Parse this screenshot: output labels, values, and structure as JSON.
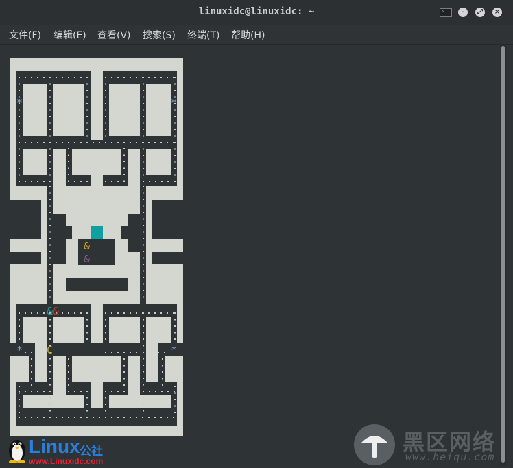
{
  "window": {
    "title": "linuxidc@linuxidc: ~"
  },
  "menu": [
    "文件(F)",
    "编辑(E)",
    "查看(V)",
    "搜索(S)",
    "终端(T)",
    "帮助(H)"
  ],
  "game": {
    "maze_rows": [
      "##############",
      "#......#.....##",
      "#.##.#.#.#.#.#",
      "*.##.#.#.#.#.*",
      "#.##.#.#.#.#.#",
      "#.##.#.#.#.#.#",
      "#.............#",
      "#.##.####.##.#",
      "#.##.####.##.#",
      "#....##.##....#",
      "###.###.###.###",
      "   .#.....#.   ",
      "   .#.###.#.   ",
      "###.#.# #.#.###",
      "   ...# #...   ",
      "###.#.###.#.###",
      "   .#.....#.   ",
      "###.#.###.#.###",
      "#.....##.....#",
      "#.##.#.#.#.#.#",
      "*..#.......#..*",
      "##.#.#####.#.##",
      "#....#.#.#....#",
      "#.######.#####.#",
      "#.............#",
      "##############"
    ],
    "ghosts": [
      {
        "glyph": "&",
        "color": "#c9a227"
      },
      {
        "glyph": "&",
        "color": "#8a5a8a"
      },
      {
        "glyph": "&",
        "color": "#1f9a9a"
      },
      {
        "glyph": "&",
        "color": "#c0392b"
      }
    ],
    "player": {
      "glyph": "C",
      "color": "#c9a227"
    },
    "power_pellet": "*",
    "pellet": "."
  },
  "branding": {
    "left_word": "Linux",
    "left_cn": "公社",
    "left_url": "www.Linuxidc.com",
    "right_cn": "黑区网络",
    "right_url": "www.heiqu.com"
  },
  "colors": {
    "wall": "#d3d7cf",
    "bg": "#2e3436",
    "pellet": "#c8ccc4",
    "power": "#7aa6d8",
    "gate": "#10a0a0"
  }
}
